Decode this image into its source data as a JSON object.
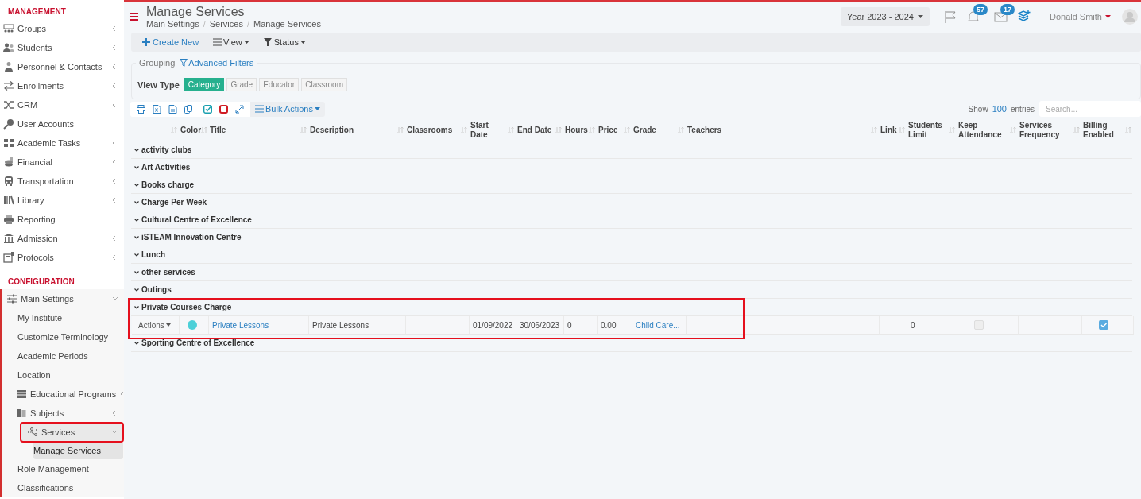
{
  "sidebar": {
    "sections": [
      {
        "heading": "MANAGEMENT",
        "items": [
          {
            "label": "Groups",
            "kind": "group",
            "expanded": false,
            "selected": false,
            "highlighted": false
          },
          {
            "label": "Students",
            "kind": "group",
            "expanded": false,
            "selected": false,
            "highlighted": false
          },
          {
            "label": "Personnel & Contacts",
            "kind": "group",
            "expanded": false,
            "selected": false,
            "highlighted": false
          },
          {
            "label": "Enrollments",
            "kind": "group",
            "expanded": false,
            "selected": false,
            "highlighted": false
          },
          {
            "label": "CRM",
            "kind": "group",
            "expanded": false,
            "selected": false,
            "highlighted": false
          },
          {
            "label": "User Accounts",
            "kind": "link",
            "selected": false,
            "highlighted": false
          },
          {
            "label": "Academic Tasks",
            "kind": "group",
            "expanded": false,
            "selected": false,
            "highlighted": false
          },
          {
            "label": "Financial",
            "kind": "group",
            "expanded": false,
            "selected": false,
            "highlighted": false
          },
          {
            "label": "Transportation",
            "kind": "group",
            "expanded": false,
            "selected": false,
            "highlighted": false
          },
          {
            "label": "Library",
            "kind": "group",
            "expanded": false,
            "selected": false,
            "highlighted": false
          },
          {
            "label": "Reporting",
            "kind": "link",
            "selected": false,
            "highlighted": false
          },
          {
            "label": "Admission",
            "kind": "group",
            "expanded": false,
            "selected": false,
            "highlighted": false
          },
          {
            "label": "Protocols",
            "kind": "group",
            "expanded": false,
            "selected": false,
            "highlighted": false
          }
        ]
      },
      {
        "heading": "CONFIGURATION",
        "items": [
          {
            "label": "Main Settings",
            "kind": "group",
            "expanded": true,
            "selected": false,
            "highlighted": false,
            "children": [
              {
                "label": "My Institute",
                "kind": "link",
                "selected": false,
                "highlighted": false
              },
              {
                "label": "Customize Terminology",
                "kind": "link",
                "selected": false,
                "highlighted": false
              },
              {
                "label": "Academic Periods",
                "kind": "link",
                "selected": false,
                "highlighted": false
              },
              {
                "label": "Location",
                "kind": "link",
                "selected": false,
                "highlighted": false
              },
              {
                "label": "Educational Programs",
                "kind": "group",
                "expanded": false,
                "selected": false,
                "highlighted": false
              },
              {
                "label": "Subjects",
                "kind": "group",
                "expanded": false,
                "selected": false,
                "highlighted": false
              },
              {
                "label": "Services",
                "kind": "group",
                "expanded": true,
                "selected": true,
                "highlighted": true,
                "children": [
                  {
                    "label": "Manage Services",
                    "selected": true,
                    "highlighted": false
                  }
                ]
              },
              {
                "label": "Role Management",
                "kind": "link",
                "selected": false,
                "highlighted": false
              },
              {
                "label": "Classifications",
                "kind": "link",
                "selected": false,
                "highlighted": false
              }
            ]
          }
        ]
      }
    ]
  },
  "header": {
    "title": "Manage Services",
    "breadcrumbs": [
      "Main Settings",
      "Services",
      "Manage Services"
    ],
    "breadcrumb_separator": "/",
    "year": "Year 2023 - 2024",
    "notifications": "57",
    "messages": "17",
    "user": "Donald Smith"
  },
  "toolbar": {
    "buttons": [
      "Create New",
      "View",
      "Status"
    ]
  },
  "filters": {
    "legend": "Grouping",
    "advanced": "Advanced Filters",
    "view_type_label": "View Type",
    "view_types": [
      {
        "label": "Category",
        "selected": true
      },
      {
        "label": "Grade",
        "selected": false
      },
      {
        "label": "Educator",
        "selected": false
      },
      {
        "label": "Classroom",
        "selected": false
      }
    ]
  },
  "table_tools": {
    "bulk_actions": "Bulk Actions",
    "show": "Show",
    "page_size": "100",
    "entries": "entries",
    "search_placeholder": "Search..."
  },
  "table": {
    "columns": [
      "Color",
      "Title",
      "Description",
      "Classrooms",
      "Start Date",
      "End Date",
      "Hours",
      "Price",
      "Grade",
      "Teachers",
      "Link",
      "Students Limit",
      "Keep Attendance",
      "Services Frequency",
      "Billing Enabled"
    ],
    "groups": [
      {
        "name": "activity clubs",
        "highlighted": false
      },
      {
        "name": "Art Activities",
        "highlighted": false
      },
      {
        "name": "Books charge",
        "highlighted": false
      },
      {
        "name": "Charge Per Week",
        "highlighted": false
      },
      {
        "name": "Cultural Centre of Excellence",
        "highlighted": false
      },
      {
        "name": "iSTEAM Innovation Centre",
        "highlighted": false
      },
      {
        "name": "Lunch",
        "highlighted": false
      },
      {
        "name": "other services",
        "highlighted": false
      },
      {
        "name": "Outings",
        "highlighted": false
      },
      {
        "name": "Private Courses Charge",
        "highlighted": true,
        "rows": [
          {
            "actions": "Actions",
            "color": "#4dd0d8",
            "title": "Private Lessons",
            "description": "Private Lessons",
            "start_date": "01/09/2022",
            "end_date": "30/06/2023",
            "hours": "0",
            "price": "0.00",
            "grade": "Child Care...",
            "students_limit": "0",
            "keep_attendance": false,
            "billing_enabled": true
          }
        ]
      },
      {
        "name": "Sporting Centre of Excellence",
        "highlighted": false
      }
    ]
  }
}
